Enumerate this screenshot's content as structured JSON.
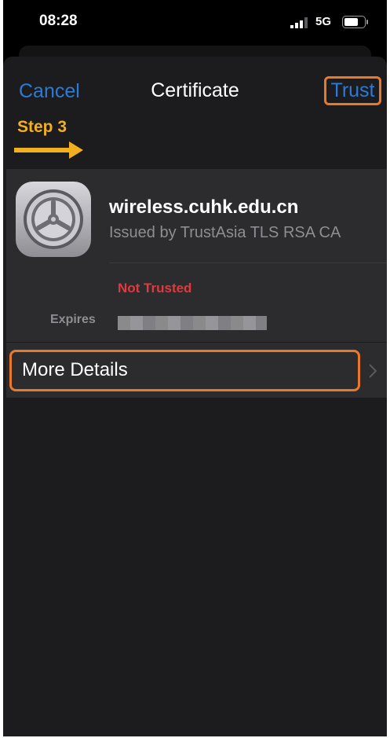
{
  "status_bar": {
    "time": "08:28",
    "network": "5G",
    "signal_icon": "cellular-signal-icon",
    "battery_icon": "battery-icon"
  },
  "nav": {
    "cancel_label": "Cancel",
    "title": "Certificate",
    "trust_label": "Trust"
  },
  "annotation": {
    "step_label": "Step 3",
    "arrow_icon": "right-arrow-icon",
    "highlight_color": "#e8792a",
    "step_color": "#f2b01e"
  },
  "certificate": {
    "icon": "settings-gear-icon",
    "name": "wireless.cuhk.edu.cn",
    "issuer": "Issued by TrustAsia TLS RSA CA",
    "status": "Not Trusted",
    "status_color": "#e5373c",
    "expires_label": "Expires"
  },
  "details": {
    "label": "More Details",
    "chevron_icon": "chevron-right-icon"
  },
  "colors": {
    "accent": "#2a7bd6",
    "sheet_background": "#1c1c1e",
    "card_background": "#2c2c2e"
  }
}
